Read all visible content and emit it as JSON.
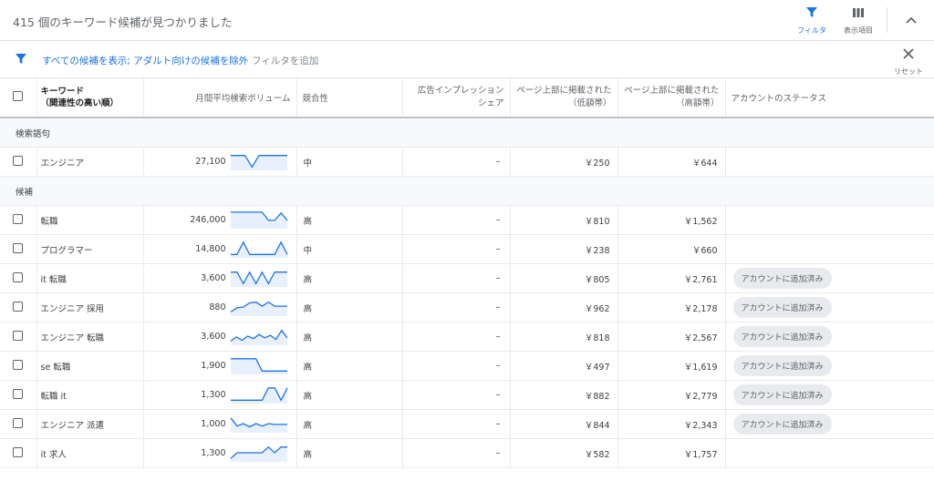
{
  "header": {
    "title": "415 個のキーワード候補が見つかりました",
    "filter_label": "フィルタ",
    "columns_label": "表示項目"
  },
  "filterbar": {
    "active_filter": "すべての候補を表示; アダルト向けの候補を除外",
    "add_filter": "フィルタを追加",
    "reset_label": "リセット"
  },
  "columns": {
    "keyword_line1": "キーワード",
    "keyword_line2": "（関連性の高い順）",
    "volume": "月間平均検索ボリューム",
    "competition": "競合性",
    "impression_line1": "広告インプレッション",
    "impression_line2": "シェア",
    "bid_low_line1": "ページ上部に掲載された",
    "bid_low_line2": "（低額帯）",
    "bid_high_line1": "ページ上部に掲載された",
    "bid_high_line2": "（高額帯）",
    "status": "アカウントのステータス"
  },
  "groups": {
    "search_terms": "検索語句",
    "suggestions": "候補"
  },
  "search_rows": [
    {
      "keyword": "エンジニア",
      "volume": "27,100",
      "trend": [
        0.85,
        0.85,
        0.85,
        0.15,
        0.85,
        0.85,
        0.85,
        0.85,
        0.85
      ],
      "competition": "中",
      "impression": "–",
      "bid_low": "￥250",
      "bid_high": "￥644",
      "status": ""
    }
  ],
  "suggestion_rows": [
    {
      "keyword": "転職",
      "volume": "246,000",
      "trend": [
        0.95,
        0.95,
        0.95,
        0.95,
        0.95,
        0.95,
        0.45,
        0.45,
        0.9,
        0.45
      ],
      "competition": "高",
      "impression": "–",
      "bid_low": "￥810",
      "bid_high": "￥1,562",
      "status": ""
    },
    {
      "keyword": "プログラマー",
      "volume": "14,800",
      "trend": [
        0.15,
        0.15,
        0.9,
        0.15,
        0.15,
        0.15,
        0.15,
        0.15,
        0.9,
        0.15
      ],
      "competition": "中",
      "impression": "–",
      "bid_low": "￥238",
      "bid_high": "￥660",
      "status": ""
    },
    {
      "keyword": "it 転職",
      "volume": "3,600",
      "trend": [
        0.85,
        0.85,
        0.15,
        0.85,
        0.15,
        0.85,
        0.15,
        0.85,
        0.85,
        0.85
      ],
      "competition": "高",
      "impression": "–",
      "bid_low": "￥805",
      "bid_high": "￥2,761",
      "status": "アカウントに追加済み"
    },
    {
      "keyword": "エンジニア 採用",
      "volume": "880",
      "trend": [
        0.2,
        0.45,
        0.5,
        0.75,
        0.8,
        0.55,
        0.8,
        0.55,
        0.55,
        0.55
      ],
      "competition": "高",
      "impression": "–",
      "bid_low": "￥962",
      "bid_high": "￥2,178",
      "status": "アカウントに追加済み"
    },
    {
      "keyword": "エンジニア 転職",
      "volume": "3,600",
      "trend": [
        0.2,
        0.45,
        0.25,
        0.5,
        0.35,
        0.6,
        0.4,
        0.55,
        0.3,
        0.85,
        0.4
      ],
      "competition": "高",
      "impression": "–",
      "bid_low": "￥818",
      "bid_high": "￥2,567",
      "status": "アカウントに追加済み"
    },
    {
      "keyword": "se 転職",
      "volume": "1,900",
      "trend": [
        0.9,
        0.9,
        0.9,
        0.9,
        0.9,
        0.15,
        0.15,
        0.15,
        0.15,
        0.15
      ],
      "competition": "高",
      "impression": "–",
      "bid_low": "￥497",
      "bid_high": "￥1,619",
      "status": "アカウントに追加済み"
    },
    {
      "keyword": "転職 it",
      "volume": "1,300",
      "trend": [
        0.15,
        0.15,
        0.15,
        0.15,
        0.15,
        0.15,
        0.9,
        0.9,
        0.15,
        0.9
      ],
      "competition": "高",
      "impression": "–",
      "bid_low": "￥882",
      "bid_high": "￥2,779",
      "status": "アカウントに追加済み"
    },
    {
      "keyword": "エンジニア 派遣",
      "volume": "1,000",
      "trend": [
        0.85,
        0.35,
        0.5,
        0.3,
        0.5,
        0.35,
        0.5,
        0.45,
        0.45,
        0.45
      ],
      "competition": "高",
      "impression": "–",
      "bid_low": "￥844",
      "bid_high": "￥2,343",
      "status": "アカウントに追加済み"
    },
    {
      "keyword": "it 求人",
      "volume": "1,300",
      "trend": [
        0.15,
        0.5,
        0.5,
        0.5,
        0.5,
        0.5,
        0.85,
        0.5,
        0.85,
        0.85
      ],
      "competition": "高",
      "impression": "–",
      "bid_low": "￥582",
      "bid_high": "￥1,757",
      "status": ""
    }
  ],
  "colors": {
    "accent": "#1a73e8",
    "spark_fill": "#e8f0fe",
    "badge_bg": "#e8eaed"
  }
}
